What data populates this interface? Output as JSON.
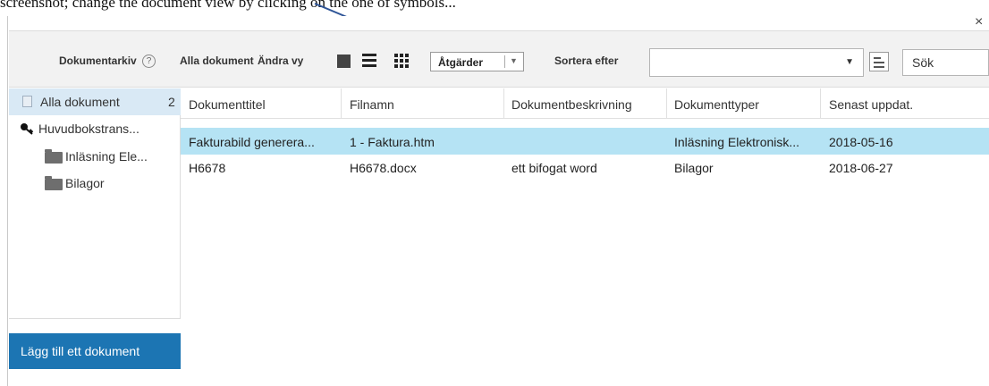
{
  "caption": "screenshot; change the document view by clicking on the one of symbols...",
  "dialog": {
    "close_label": "×"
  },
  "toolbar": {
    "archive_label": "Dokumentarkiv",
    "help_label": "?",
    "all_docs_label": "Alla dokument",
    "change_view_label": "Ändra vy",
    "actions_label": "Åtgärder",
    "sort_label": "Sortera efter",
    "sort_value": "",
    "search_placeholder": "Sök"
  },
  "sidebar": {
    "items": [
      {
        "label": "Alla dokument",
        "count": "2",
        "icon": "document-icon"
      },
      {
        "label": "Huvudbokstrans...",
        "icon": "key-icon"
      },
      {
        "label": "Inläsning Ele...",
        "icon": "folder-icon"
      },
      {
        "label": "Bilagor",
        "icon": "folder-icon"
      }
    ],
    "add_button_label": "Lägg till ett dokument"
  },
  "table": {
    "columns": [
      "Dokumenttitel",
      "Filnamn",
      "Dokumentbeskrivning",
      "Dokumenttyper",
      "Senast uppdat."
    ],
    "rows": [
      [
        "Fakturabild generera...",
        "1 - Faktura.htm",
        "",
        "Inläsning Elektronisk...",
        "2018-05-16"
      ],
      [
        "H6678",
        "H6678.docx",
        "ett bifogat word",
        "Bilagor",
        "2018-06-27"
      ]
    ]
  },
  "colors": {
    "accent": "#1c75b3",
    "selected_row": "#b5e3f4",
    "active_sidebar": "#d9e9f5",
    "toolbar_bg": "#f2f2f2",
    "arrow": "#2f5597"
  }
}
